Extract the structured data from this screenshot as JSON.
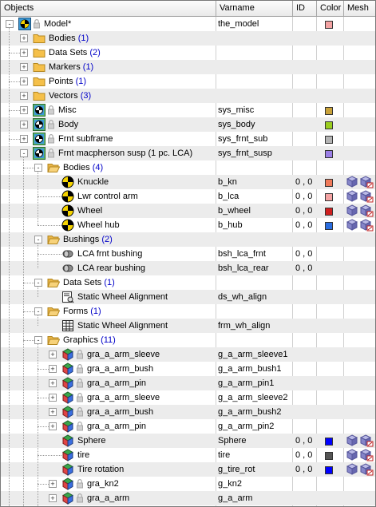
{
  "header": {
    "objects": "Objects",
    "varname": "Varname",
    "id": "ID",
    "color": "Color",
    "mesh": "Mesh"
  },
  "rows": [
    {
      "label": "Model*",
      "count": "",
      "varname": "the_model",
      "id": "",
      "color": "#f4a3a3",
      "icon": "model",
      "level": 0,
      "exp": "-",
      "lock": true,
      "mesh": false
    },
    {
      "label": "Bodies ",
      "count": "(1)",
      "varname": "",
      "id": "",
      "color": "",
      "icon": "folder-closed",
      "level": 1,
      "exp": "+",
      "lock": false,
      "mesh": false
    },
    {
      "label": "Data Sets ",
      "count": "(2)",
      "varname": "",
      "id": "",
      "color": "",
      "icon": "folder-closed",
      "level": 1,
      "exp": "+",
      "lock": false,
      "mesh": false
    },
    {
      "label": "Markers ",
      "count": "(1)",
      "varname": "",
      "id": "",
      "color": "",
      "icon": "folder-closed",
      "level": 1,
      "exp": "+",
      "lock": false,
      "mesh": false
    },
    {
      "label": "Points ",
      "count": "(1)",
      "varname": "",
      "id": "",
      "color": "",
      "icon": "folder-closed",
      "level": 1,
      "exp": "+",
      "lock": false,
      "mesh": false
    },
    {
      "label": "Vectors ",
      "count": "(3)",
      "varname": "",
      "id": "",
      "color": "",
      "icon": "folder-closed",
      "level": 1,
      "exp": "+",
      "lock": false,
      "mesh": false
    },
    {
      "label": "Misc",
      "count": "",
      "varname": "sys_misc",
      "id": "",
      "color": "#c9a23a",
      "icon": "system",
      "level": 1,
      "exp": "+",
      "lock": true,
      "mesh": false
    },
    {
      "label": "Body",
      "count": "",
      "varname": "sys_body",
      "id": "",
      "color": "#9acd1e",
      "icon": "system",
      "level": 1,
      "exp": "+",
      "lock": true,
      "mesh": false
    },
    {
      "label": "Frnt subframe",
      "count": "",
      "varname": "sys_frnt_sub",
      "id": "",
      "color": "#b4b4b4",
      "icon": "system",
      "level": 1,
      "exp": "+",
      "lock": true,
      "mesh": false
    },
    {
      "label": "Frnt macpherson susp (1 pc. LCA)",
      "count": "",
      "varname": "sys_frnt_susp",
      "id": "",
      "color": "#9b7fe6",
      "icon": "system",
      "level": 1,
      "exp": "-",
      "lock": true,
      "mesh": false
    },
    {
      "label": "Bodies ",
      "count": "(4)",
      "varname": "",
      "id": "",
      "color": "",
      "icon": "folder-open",
      "level": 2,
      "exp": "-",
      "lock": false,
      "mesh": false
    },
    {
      "label": "Knuckle",
      "count": "",
      "varname": "b_kn",
      "id": "0 , 0",
      "color": "#f07a5a",
      "icon": "body",
      "level": 3,
      "exp": "",
      "lock": false,
      "mesh": true
    },
    {
      "label": "Lwr control arm",
      "count": "",
      "varname": "b_lca",
      "id": "0 , 0",
      "color": "#f4a3a3",
      "icon": "body",
      "level": 3,
      "exp": "",
      "lock": false,
      "mesh": true
    },
    {
      "label": "Wheel",
      "count": "",
      "varname": "b_wheel",
      "id": "0 , 0",
      "color": "#d02020",
      "icon": "body",
      "level": 3,
      "exp": "",
      "lock": false,
      "mesh": true
    },
    {
      "label": "Wheel hub",
      "count": "",
      "varname": "b_hub",
      "id": "0 , 0",
      "color": "#2a6de0",
      "icon": "body",
      "level": 3,
      "exp": "",
      "lock": false,
      "mesh": true
    },
    {
      "label": "Bushings ",
      "count": "(2)",
      "varname": "",
      "id": "",
      "color": "",
      "icon": "folder-open",
      "level": 2,
      "exp": "-",
      "lock": false,
      "mesh": false
    },
    {
      "label": "LCA frnt bushing",
      "count": "",
      "varname": "bsh_lca_frnt",
      "id": "0 , 0",
      "color": "",
      "icon": "bushing",
      "level": 3,
      "exp": "",
      "lock": false,
      "mesh": false
    },
    {
      "label": "LCA rear bushing",
      "count": "",
      "varname": "bsh_lca_rear",
      "id": "0 , 0",
      "color": "",
      "icon": "bushing",
      "level": 3,
      "exp": "",
      "lock": false,
      "mesh": false
    },
    {
      "label": "Data Sets ",
      "count": "(1)",
      "varname": "",
      "id": "",
      "color": "",
      "icon": "folder-open",
      "level": 2,
      "exp": "-",
      "lock": false,
      "mesh": false
    },
    {
      "label": "Static Wheel Alignment",
      "count": "",
      "varname": "ds_wh_align",
      "id": "",
      "color": "",
      "icon": "dataset",
      "level": 3,
      "exp": "",
      "lock": false,
      "mesh": false
    },
    {
      "label": "Forms ",
      "count": "(1)",
      "varname": "",
      "id": "",
      "color": "",
      "icon": "folder-open",
      "level": 2,
      "exp": "-",
      "lock": false,
      "mesh": false
    },
    {
      "label": "Static Wheel Alignment",
      "count": "",
      "varname": "frm_wh_align",
      "id": "",
      "color": "",
      "icon": "form",
      "level": 3,
      "exp": "",
      "lock": false,
      "mesh": false
    },
    {
      "label": "Graphics ",
      "count": "(11)",
      "varname": "",
      "id": "",
      "color": "",
      "icon": "folder-open",
      "level": 2,
      "exp": "-",
      "lock": false,
      "mesh": false
    },
    {
      "label": "gra_a_arm_sleeve",
      "count": "",
      "varname": "g_a_arm_sleeve1",
      "id": "",
      "color": "",
      "icon": "graphic",
      "level": 3,
      "exp": "+",
      "lock": true,
      "mesh": false
    },
    {
      "label": "gra_a_arm_bush",
      "count": "",
      "varname": "g_a_arm_bush1",
      "id": "",
      "color": "",
      "icon": "graphic",
      "level": 3,
      "exp": "+",
      "lock": true,
      "mesh": false
    },
    {
      "label": "gra_a_arm_pin",
      "count": "",
      "varname": "g_a_arm_pin1",
      "id": "",
      "color": "",
      "icon": "graphic",
      "level": 3,
      "exp": "+",
      "lock": true,
      "mesh": false
    },
    {
      "label": "gra_a_arm_sleeve",
      "count": "",
      "varname": "g_a_arm_sleeve2",
      "id": "",
      "color": "",
      "icon": "graphic",
      "level": 3,
      "exp": "+",
      "lock": true,
      "mesh": false
    },
    {
      "label": "gra_a_arm_bush",
      "count": "",
      "varname": "g_a_arm_bush2",
      "id": "",
      "color": "",
      "icon": "graphic",
      "level": 3,
      "exp": "+",
      "lock": true,
      "mesh": false
    },
    {
      "label": "gra_a_arm_pin",
      "count": "",
      "varname": "g_a_arm_pin2",
      "id": "",
      "color": "",
      "icon": "graphic",
      "level": 3,
      "exp": "+",
      "lock": true,
      "mesh": false
    },
    {
      "label": "Sphere",
      "count": "",
      "varname": "Sphere",
      "id": "0 , 0",
      "color": "#0000ff",
      "icon": "graphic",
      "level": 3,
      "exp": "",
      "lock": false,
      "mesh": true
    },
    {
      "label": "tire",
      "count": "",
      "varname": "tire",
      "id": "0 , 0",
      "color": "#555555",
      "icon": "graphic",
      "level": 3,
      "exp": "",
      "lock": false,
      "mesh": true
    },
    {
      "label": "Tire rotation",
      "count": "",
      "varname": "g_tire_rot",
      "id": "0 , 0",
      "color": "#0000ff",
      "icon": "graphic",
      "level": 3,
      "exp": "",
      "lock": false,
      "mesh": true
    },
    {
      "label": "gra_kn2",
      "count": "",
      "varname": "g_kn2",
      "id": "",
      "color": "",
      "icon": "graphic",
      "level": 3,
      "exp": "+",
      "lock": true,
      "mesh": false
    },
    {
      "label": "gra_a_arm",
      "count": "",
      "varname": "g_a_arm",
      "id": "",
      "color": "",
      "icon": "graphic",
      "level": 3,
      "exp": "+",
      "lock": true,
      "mesh": false
    }
  ]
}
